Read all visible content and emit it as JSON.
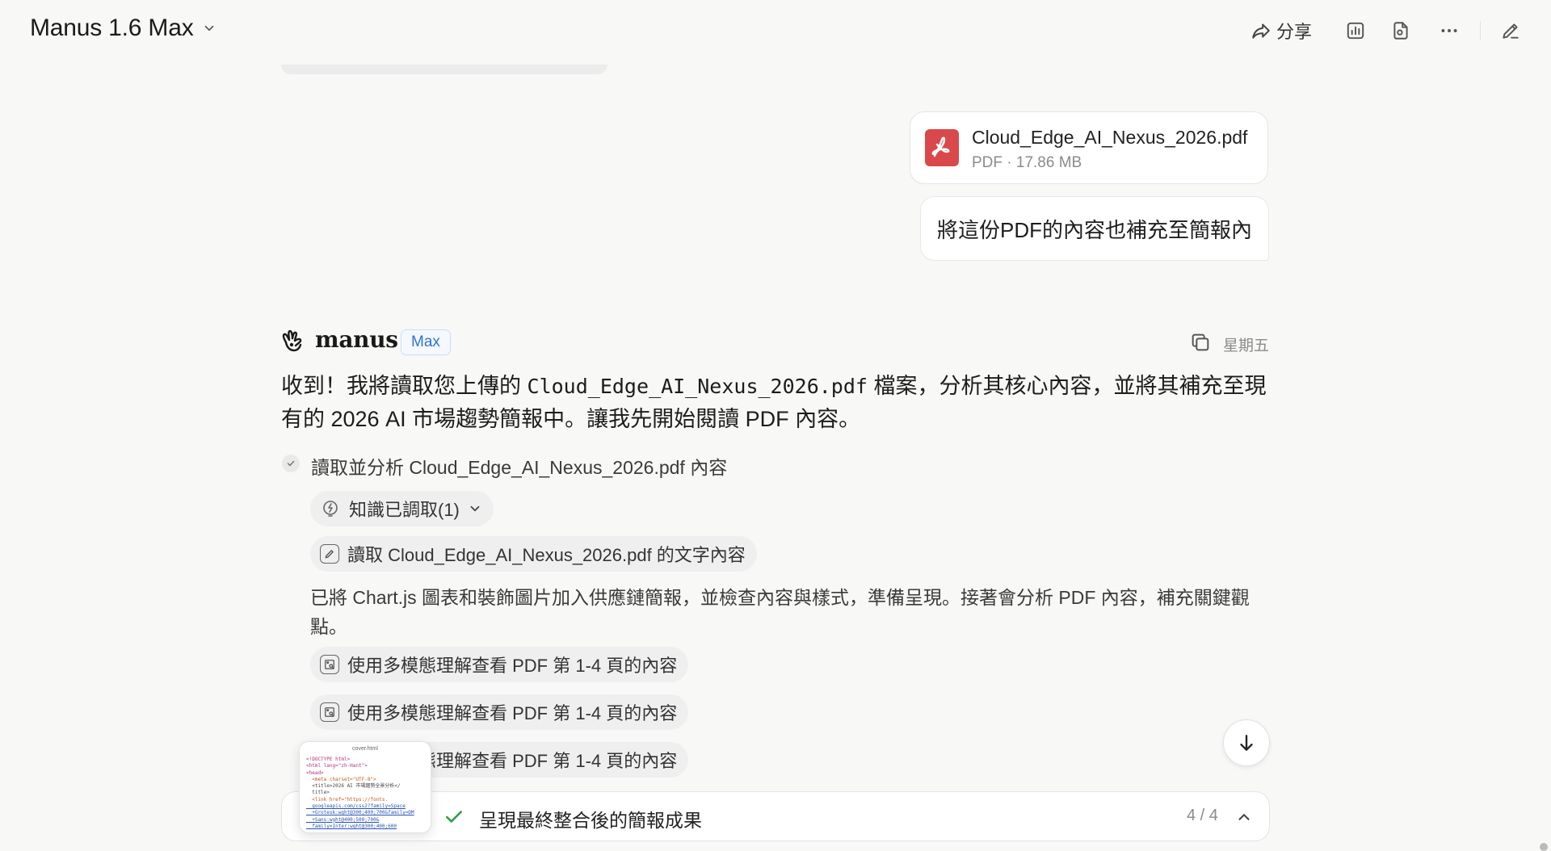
{
  "header": {
    "model_title": "Manus 1.6 Max",
    "share_label": "分享",
    "icons": [
      "share-icon",
      "chart-icon",
      "file-icon",
      "more-icon",
      "edit-icon"
    ]
  },
  "user": {
    "attachment": {
      "name": "Cloud_Edge_AI_Nexus_2026.pdf",
      "meta": "PDF · 17.86 MB"
    },
    "message": "將這份PDF的內容也補充至簡報內"
  },
  "assistant": {
    "name": "manus",
    "badge": "Max",
    "timestamp": "星期五",
    "reply_part1": "收到！我將讀取您上傳的 ",
    "reply_code": "Cloud_Edge_AI_Nexus_2026.pdf",
    "reply_part2": " 檔案，分析其核心內容，並將其補充至現有的 2026 AI 市場趨勢簡報中。讓我先開始閱讀 PDF 內容。",
    "step_title": "讀取並分析 Cloud_Edge_AI_Nexus_2026.pdf 內容",
    "knowledge_label": "知識已調取(1)",
    "read_action": "讀取 Cloud_Edge_AI_Nexus_2026.pdf 的文字內容",
    "narration": "已將 Chart.js 圖表和裝飾圖片加入供應鏈簡報，並檢查內容與樣式，準備呈現。接著會分析 PDF 內容，補充關鍵觀點。",
    "multimodal_actions": [
      "使用多模態理解查看 PDF 第 1-4 頁的內容",
      "使用多模態理解查看 PDF 第 1-4 頁的內容",
      "使用多模態理解查看 PDF 第 1-4 頁的內容"
    ]
  },
  "task": {
    "label": "呈現最終整合後的簡報成果",
    "progress": "4 / 4"
  },
  "thumbnail": {
    "title": "cover.html",
    "code_lines": [
      "<!DOCTYPE html>",
      "<html lang=\"zh-Hant\">",
      "<head>",
      "  <meta charset=\"UTF-8\">",
      "  <title>2026 AI 市場趨勢全景分析</",
      "  title>",
      "  <link href=\"https://fonts.",
      "  googleapis.com/css2?family=Space",
      "  +Grotesk:wght@300;400;700&family=DM",
      "  +Sans:wght@400;500;700&",
      "  family=Inter:wght@300;400;600"
    ]
  },
  "colors": {
    "accent_blue": "#2f72d6",
    "pdf_red": "#d9494b",
    "check_green": "#2f9e44"
  }
}
